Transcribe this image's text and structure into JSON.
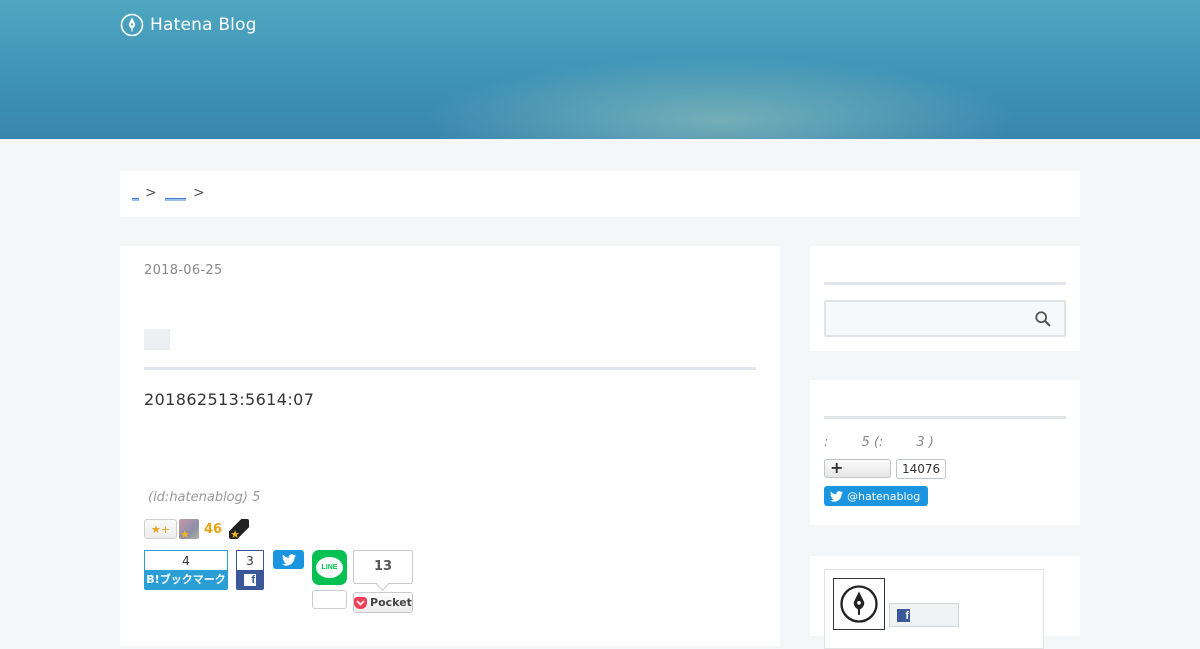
{
  "header": {
    "logo_text": "Hatena Blog",
    "logo_icon": "hatena-pen-icon",
    "gradient_colors": [
      "#4fa7c0",
      "#3a86af"
    ]
  },
  "breadcrumb": {
    "items": [
      "_",
      "___"
    ],
    "separator": ">"
  },
  "article": {
    "date": "2018-06-25",
    "timestamp": "201862513:5614:07",
    "author": " (id:hatenablog) 5",
    "stars": {
      "add_label": "★+",
      "count": "46"
    },
    "share": {
      "hatena_bookmark_count": "4",
      "hatena_bookmark_label": "B!ブックマーク",
      "facebook_count": "3",
      "facebook_icon": "facebook-icon",
      "twitter_icon": "twitter-icon",
      "line_label": "LINE",
      "pocket_count": "13",
      "pocket_label": "Pocket"
    }
  },
  "sidebar": {
    "search": {
      "placeholder": "",
      "icon": "search-icon"
    },
    "subscribe": {
      "info_text": ":        5 (:        3 )",
      "follow_icon": "plus-icon",
      "follow_count": "14076",
      "twitter_handle": "@hatenablog"
    },
    "profile": {
      "icon": "hatena-pen-icon",
      "facebook_icon": "facebook-icon"
    }
  },
  "colors": {
    "accent_link": "#3a7fd0",
    "hatena_blue": "#2c9ed6",
    "facebook_blue": "#3b5998",
    "twitter_blue": "#1b95e0",
    "line_green": "#06c152",
    "pocket_red": "#ef4056",
    "star_gold": "#e6a417"
  }
}
